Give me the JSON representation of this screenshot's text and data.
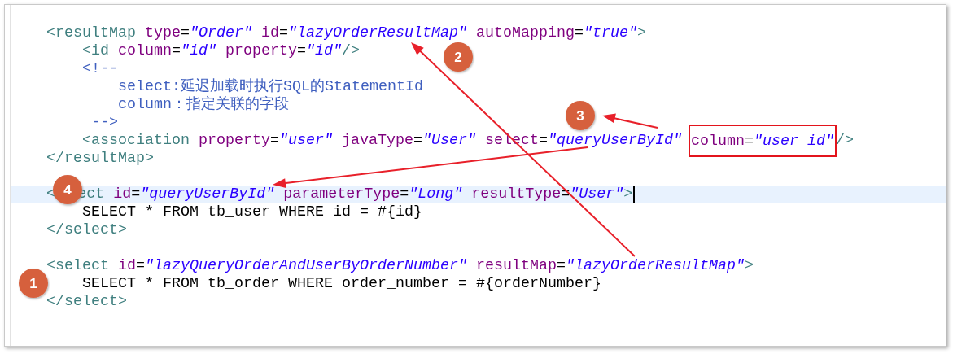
{
  "editor": {
    "lines": [
      {
        "current": false,
        "tokens": [
          {
            "kind": "tag",
            "text": "<resultMap"
          },
          {
            "kind": "attr",
            "text": " type"
          },
          {
            "kind": "text",
            "text": "="
          },
          {
            "kind": "value",
            "text": "\"Order\""
          },
          {
            "kind": "attr",
            "text": " id"
          },
          {
            "kind": "text",
            "text": "="
          },
          {
            "kind": "value",
            "text": "\"lazyOrderResultMap\""
          },
          {
            "kind": "attr",
            "text": " autoMapping"
          },
          {
            "kind": "text",
            "text": "="
          },
          {
            "kind": "value",
            "text": "\"true\""
          },
          {
            "kind": "tag",
            "text": ">"
          }
        ]
      },
      {
        "current": false,
        "tokens": [
          {
            "kind": "tag",
            "text": "    <id"
          },
          {
            "kind": "attr",
            "text": " column"
          },
          {
            "kind": "text",
            "text": "="
          },
          {
            "kind": "value",
            "text": "\"id\""
          },
          {
            "kind": "attr",
            "text": " property"
          },
          {
            "kind": "text",
            "text": "="
          },
          {
            "kind": "value",
            "text": "\"id\""
          },
          {
            "kind": "tag",
            "text": "/>"
          }
        ]
      },
      {
        "current": false,
        "tokens": [
          {
            "kind": "comment",
            "text": "    <!--"
          }
        ]
      },
      {
        "current": false,
        "tokens": [
          {
            "kind": "comment",
            "text": "        select:延迟加载时执行SQL的StatementId"
          }
        ]
      },
      {
        "current": false,
        "tokens": [
          {
            "kind": "comment",
            "text": "        column：指定关联的字段"
          }
        ]
      },
      {
        "current": false,
        "tokens": [
          {
            "kind": "comment",
            "text": "     -->"
          }
        ]
      },
      {
        "current": false,
        "tokens": [
          {
            "kind": "tag",
            "text": "    <association"
          },
          {
            "kind": "attr",
            "text": " property"
          },
          {
            "kind": "text",
            "text": "="
          },
          {
            "kind": "value",
            "text": "\"user\""
          },
          {
            "kind": "attr",
            "text": " javaType"
          },
          {
            "kind": "text",
            "text": "="
          },
          {
            "kind": "value",
            "text": "\"User\""
          },
          {
            "kind": "attr",
            "text": " select"
          },
          {
            "kind": "text",
            "text": "="
          },
          {
            "kind": "value",
            "text": "\"queryUserById\""
          },
          {
            "kind": "box",
            "tokens": [
              {
                "kind": "attr",
                "text": "column"
              },
              {
                "kind": "text",
                "text": "="
              },
              {
                "kind": "value",
                "text": "\"user_id\""
              }
            ]
          },
          {
            "kind": "tag",
            "text": "/>"
          }
        ]
      },
      {
        "current": false,
        "tokens": [
          {
            "kind": "tag",
            "text": "</resultMap>"
          }
        ]
      },
      {
        "current": false
      },
      {
        "current": true,
        "tokens": [
          {
            "kind": "tag",
            "text": "<"
          },
          {
            "kind": "covered"
          },
          {
            "kind": "tag",
            "text": "ect"
          },
          {
            "kind": "attr",
            "text": " id"
          },
          {
            "kind": "text",
            "text": "="
          },
          {
            "kind": "value",
            "text": "\"queryUserById\""
          },
          {
            "kind": "attr",
            "text": " parameterType"
          },
          {
            "kind": "text",
            "text": "="
          },
          {
            "kind": "value",
            "text": "\"Long\""
          },
          {
            "kind": "attr",
            "text": " resultType"
          },
          {
            "kind": "text",
            "text": "="
          },
          {
            "kind": "value",
            "text": "\"User\""
          },
          {
            "kind": "tag",
            "text": ">"
          }
        ]
      },
      {
        "current": false,
        "tokens": [
          {
            "kind": "text",
            "text": "    SELECT * FROM tb_user WHERE id = #{id}"
          }
        ]
      },
      {
        "current": false,
        "tokens": [
          {
            "kind": "tag",
            "text": "</select>"
          }
        ]
      },
      {
        "current": false
      },
      {
        "current": false,
        "tokens": [
          {
            "kind": "tag",
            "text": "<select"
          },
          {
            "kind": "attr",
            "text": " id"
          },
          {
            "kind": "text",
            "text": "="
          },
          {
            "kind": "value",
            "text": "\"lazyQueryOrderAndUserByOrderNumber\""
          },
          {
            "kind": "attr",
            "text": " resultMap"
          },
          {
            "kind": "text",
            "text": "="
          },
          {
            "kind": "value",
            "text": "\"lazyOrderResultMap\""
          },
          {
            "kind": "tag",
            "text": ">"
          }
        ]
      },
      {
        "current": false,
        "tokens": [
          {
            "kind": "text",
            "text": "    SELECT * FROM tb_order WHERE order_number = #{orderNumber}"
          }
        ]
      },
      {
        "current": false,
        "tokens": [
          {
            "kind": "tag",
            "text": "</select>"
          }
        ]
      }
    ]
  },
  "annotations": {
    "badges": [
      {
        "number": "1"
      },
      {
        "number": "2"
      },
      {
        "number": "3"
      },
      {
        "number": "4"
      }
    ]
  }
}
